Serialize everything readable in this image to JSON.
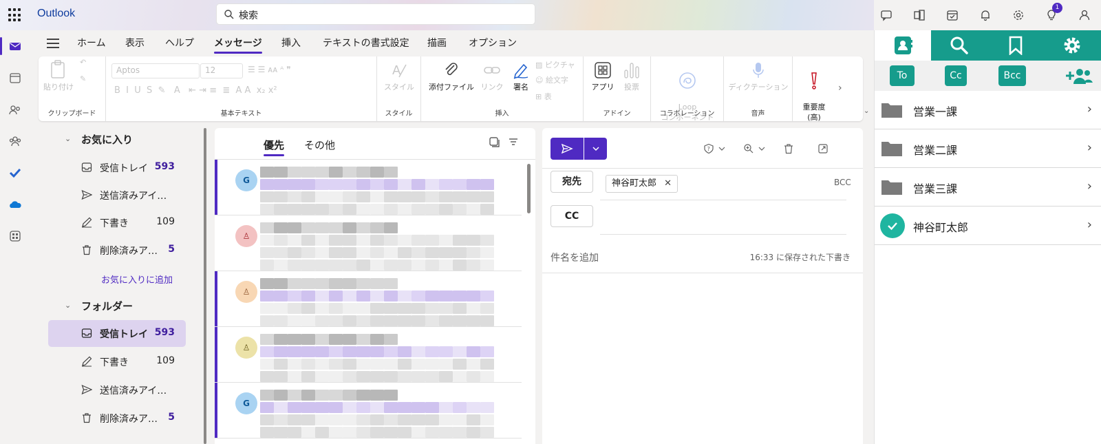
{
  "app": {
    "title": "Outlook"
  },
  "search": {
    "placeholder": "検索"
  },
  "topbar": {
    "notification_count": "1"
  },
  "ribbon_tabs": [
    "ホーム",
    "表示",
    "ヘルプ",
    "メッセージ",
    "挿入",
    "テキストの書式設定",
    "描画",
    "オプション"
  ],
  "ribbon": {
    "paste": "貼り付け",
    "group_clipboard": "クリップボード",
    "font_name": "Aptos",
    "font_size": "12",
    "group_basic_text": "基本テキスト",
    "style": "スタイル",
    "group_style": "スタイル",
    "attach": "添付ファイル",
    "link": "リンク",
    "signature": "署名",
    "picture": "ピクチャ",
    "emoji": "絵文字",
    "table": "表",
    "group_insert": "挿入",
    "apps": "アプリ",
    "poll": "投票",
    "group_addin": "アドイン",
    "loop": "Loop\nコンポーネント",
    "group_collab": "コラボレーション",
    "dictation": "ディクテーション",
    "group_voice": "音声",
    "importance": "重要度\n(高)"
  },
  "folders": {
    "favorites_label": "お気に入り",
    "favorites": [
      {
        "name": "受信トレイ",
        "count": "593",
        "unread": true,
        "icon": "inbox-icon"
      },
      {
        "name": "送信済みアイ…",
        "count": "",
        "unread": false,
        "icon": "send-icon"
      },
      {
        "name": "下書き",
        "count": "109",
        "unread": false,
        "icon": "draft-icon"
      },
      {
        "name": "削除済みア…",
        "count": "5",
        "unread": true,
        "icon": "trash-icon"
      }
    ],
    "add_favorite": "お気に入りに追加",
    "folders_label": "フォルダー",
    "items": [
      {
        "name": "受信トレイ",
        "count": "593",
        "unread": true,
        "icon": "inbox-icon"
      },
      {
        "name": "下書き",
        "count": "109",
        "unread": false,
        "icon": "draft-icon"
      },
      {
        "name": "送信済みアイ…",
        "count": "",
        "unread": false,
        "icon": "send-icon"
      },
      {
        "name": "削除済みア…",
        "count": "5",
        "unread": true,
        "icon": "trash-icon"
      }
    ]
  },
  "message_list": {
    "tab_focused": "優先",
    "tab_other": "その他",
    "avatars": [
      {
        "initial": "G",
        "bg": "#a9d3f2",
        "fg": "#0f5a99"
      },
      {
        "initial": "",
        "bg": "#f3c2c2",
        "fg": "#a4262c"
      },
      {
        "initial": "",
        "bg": "#f8d7b4",
        "fg": "#8e562e"
      },
      {
        "initial": "",
        "bg": "#ece2a8",
        "fg": "#6a5c1c"
      },
      {
        "initial": "G",
        "bg": "#a9d3f2",
        "fg": "#0f5a99"
      }
    ]
  },
  "compose": {
    "to_label": "宛先",
    "cc_label": "CC",
    "bcc_label": "BCC",
    "recipient": "神谷町太郎",
    "subject_placeholder": "件名を追加",
    "saved_text": "16:33 に保存された下書き"
  },
  "addin": {
    "to": "To",
    "cc": "Cc",
    "bcc": "Bcc",
    "rows": [
      {
        "name": "営業一課",
        "type": "folder"
      },
      {
        "name": "営業二課",
        "type": "folder"
      },
      {
        "name": "営業三課",
        "type": "folder"
      },
      {
        "name": "神谷町太郎",
        "type": "person"
      }
    ]
  },
  "colors": {
    "accent": "#4f2ac2",
    "addin_teal": "#169c8c"
  }
}
